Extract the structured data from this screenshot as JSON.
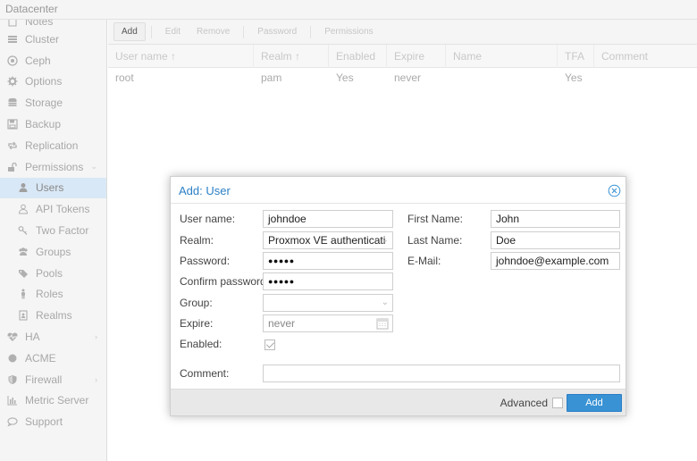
{
  "header": {
    "title": "Datacenter"
  },
  "sidebar": {
    "items": [
      {
        "label": "Notes",
        "icon": "notes-icon"
      },
      {
        "label": "Cluster",
        "icon": "cluster-icon"
      },
      {
        "label": "Ceph",
        "icon": "ceph-icon"
      },
      {
        "label": "Options",
        "icon": "gear-icon"
      },
      {
        "label": "Storage",
        "icon": "database-icon"
      },
      {
        "label": "Backup",
        "icon": "floppy-icon"
      },
      {
        "label": "Replication",
        "icon": "retweet-icon"
      },
      {
        "label": "Permissions",
        "icon": "unlock-icon"
      },
      {
        "label": "Users",
        "icon": "user-icon"
      },
      {
        "label": "API Tokens",
        "icon": "user-outline-icon"
      },
      {
        "label": "Two Factor",
        "icon": "key-icon"
      },
      {
        "label": "Groups",
        "icon": "users-icon"
      },
      {
        "label": "Pools",
        "icon": "tags-icon"
      },
      {
        "label": "Roles",
        "icon": "male-icon"
      },
      {
        "label": "Realms",
        "icon": "address-book-icon"
      },
      {
        "label": "HA",
        "icon": "heartbeat-icon"
      },
      {
        "label": "ACME",
        "icon": "certificate-icon"
      },
      {
        "label": "Firewall",
        "icon": "shield-icon"
      },
      {
        "label": "Metric Server",
        "icon": "bar-chart-icon"
      },
      {
        "label": "Support",
        "icon": "comments-icon"
      }
    ]
  },
  "toolbar": {
    "add": "Add",
    "edit": "Edit",
    "remove": "Remove",
    "password": "Password",
    "permissions": "Permissions"
  },
  "grid": {
    "columns": [
      "User name ↑",
      "Realm ↑",
      "Enabled",
      "Expire",
      "Name",
      "TFA",
      "Comment"
    ],
    "rows": [
      {
        "username": "root",
        "realm": "pam",
        "enabled": "Yes",
        "expire": "never",
        "name": "",
        "tfa": "Yes",
        "comment": ""
      }
    ]
  },
  "dialog": {
    "title": "Add: User",
    "labels": {
      "username": "User name:",
      "realm": "Realm:",
      "password": "Password:",
      "confirm": "Confirm password:",
      "group": "Group:",
      "expire": "Expire:",
      "enabled": "Enabled:",
      "comment": "Comment:",
      "firstname": "First Name:",
      "lastname": "Last Name:",
      "email": "E-Mail:"
    },
    "values": {
      "username": "johndoe",
      "realm": "Proxmox VE authenticati",
      "password": "●●●●●",
      "confirm": "●●●●●",
      "group": "",
      "expire": "never",
      "enabled": true,
      "comment": "",
      "firstname": "John",
      "lastname": "Doe",
      "email": "johndoe@example.com"
    },
    "footer": {
      "advanced": "Advanced",
      "advanced_checked": false,
      "add": "Add"
    }
  },
  "colors": {
    "accent": "#3892d4",
    "title": "#2b7fc6",
    "selected": "#d9e8f6"
  }
}
